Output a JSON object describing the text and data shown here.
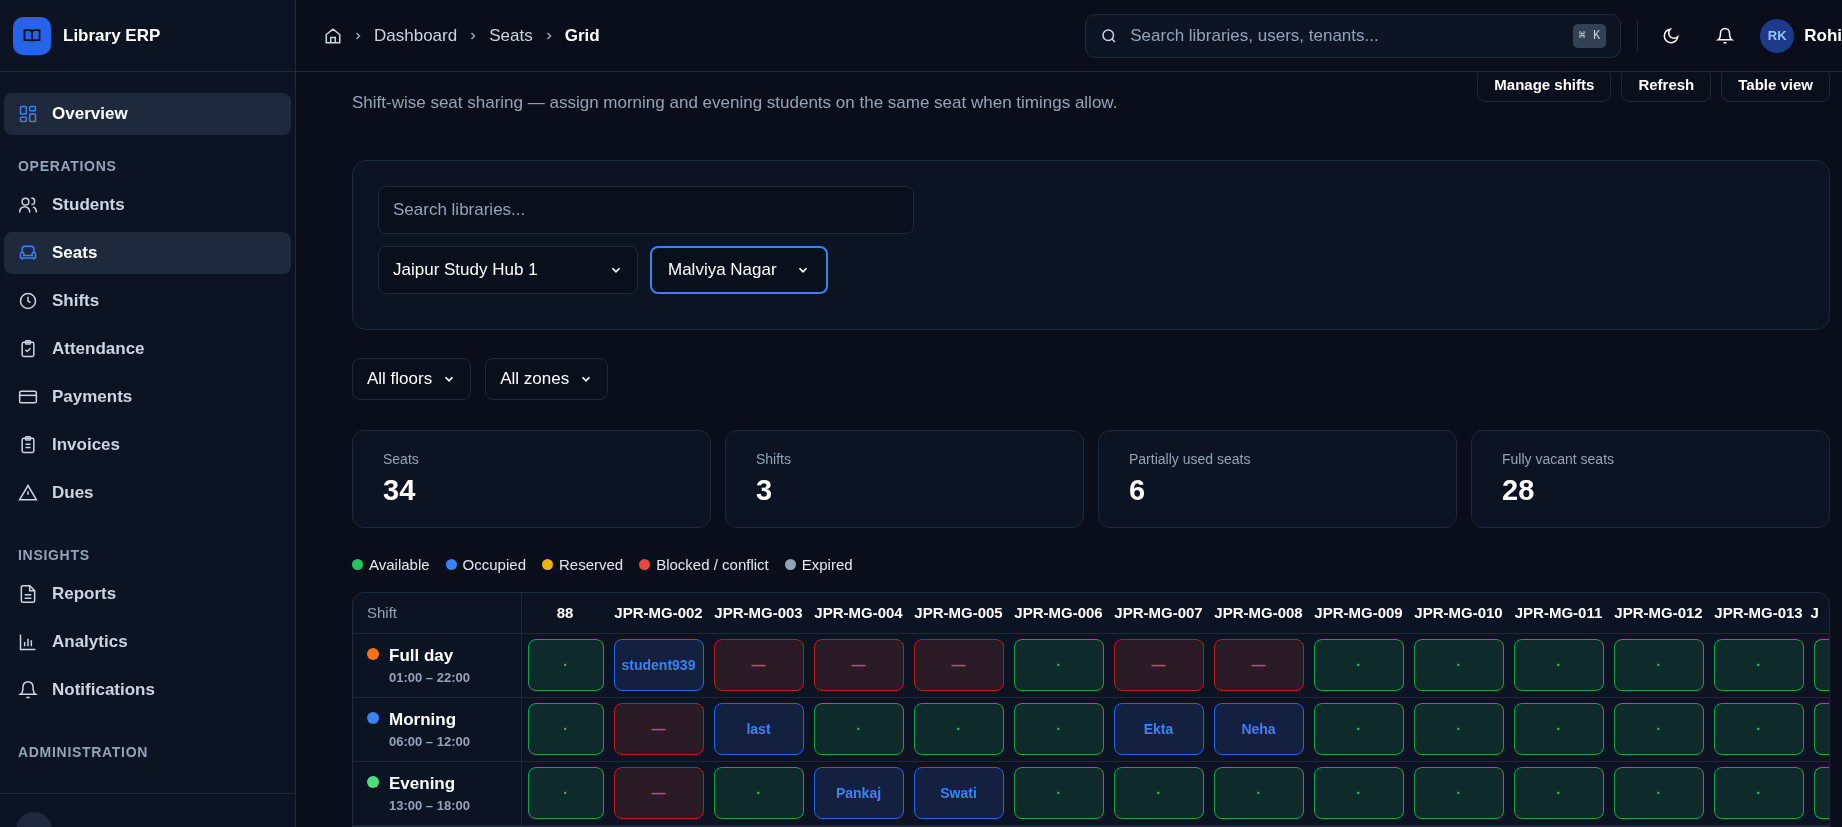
{
  "app": {
    "name": "Library ERP"
  },
  "sidebar": {
    "sections": [
      {
        "items": [
          {
            "label": "Overview",
            "selected": true
          }
        ]
      },
      {
        "title": "OPERATIONS",
        "items": [
          {
            "label": "Students",
            "selected": false
          },
          {
            "label": "Seats",
            "selected": true
          },
          {
            "label": "Shifts",
            "selected": false
          },
          {
            "label": "Attendance",
            "selected": false
          },
          {
            "label": "Payments",
            "selected": false
          },
          {
            "label": "Invoices",
            "selected": false
          },
          {
            "label": "Dues",
            "selected": false
          }
        ]
      },
      {
        "title": "INSIGHTS",
        "items": [
          {
            "label": "Reports",
            "selected": false
          },
          {
            "label": "Analytics",
            "selected": false
          },
          {
            "label": "Notifications",
            "selected": false
          }
        ]
      },
      {
        "title": "ADMINISTRATION"
      }
    ]
  },
  "breadcrumb": [
    "Dashboard",
    "Seats",
    "Grid"
  ],
  "search": {
    "placeholder": "Search libraries, users, tenants...",
    "shortcut": "⌘ K"
  },
  "user": {
    "initials": "RK",
    "name": "Rohi"
  },
  "subtitle": "Shift-wise seat sharing — assign morning and evening students on the same seat when timings allow.",
  "actions": [
    "Manage shifts",
    "Refresh",
    "Table view"
  ],
  "library_filter": {
    "placeholder": "Search libraries...",
    "library": "Jaipur Study Hub 1",
    "branch": "Malviya Nagar"
  },
  "filters": [
    "All floors",
    "All zones"
  ],
  "stats": [
    {
      "label": "Seats",
      "value": "34"
    },
    {
      "label": "Shifts",
      "value": "3"
    },
    {
      "label": "Partially used seats",
      "value": "6"
    },
    {
      "label": "Fully vacant seats",
      "value": "28"
    }
  ],
  "legend": [
    {
      "label": "Available",
      "color": "#22c55e"
    },
    {
      "label": "Occupied",
      "color": "#3b82f6"
    },
    {
      "label": "Reserved",
      "color": "#eab308"
    },
    {
      "label": "Blocked / conflict",
      "color": "#ef4444"
    },
    {
      "label": "Expired",
      "color": "#94a3b8"
    }
  ],
  "table": {
    "shift_header": "Shift",
    "columns": [
      "88",
      "JPR-MG-002",
      "JPR-MG-003",
      "JPR-MG-004",
      "JPR-MG-005",
      "JPR-MG-006",
      "JPR-MG-007",
      "JPR-MG-008",
      "JPR-MG-009",
      "JPR-MG-010",
      "JPR-MG-011",
      "JPR-MG-012",
      "JPR-MG-013",
      "J"
    ],
    "rows": [
      {
        "name": "Full day",
        "time": "01:00 – 22:00",
        "color": "#f97316",
        "cells": [
          {
            "kind": "available",
            "text": "·"
          },
          {
            "kind": "occupied",
            "text": "student939"
          },
          {
            "kind": "blocked",
            "text": "—"
          },
          {
            "kind": "blocked",
            "text": "—"
          },
          {
            "kind": "blocked",
            "text": "—"
          },
          {
            "kind": "available",
            "text": "·"
          },
          {
            "kind": "blocked",
            "text": "—"
          },
          {
            "kind": "blocked",
            "text": "—"
          },
          {
            "kind": "available",
            "text": "·"
          },
          {
            "kind": "available",
            "text": "·"
          },
          {
            "kind": "available",
            "text": "·"
          },
          {
            "kind": "available",
            "text": "·"
          },
          {
            "kind": "available",
            "text": "·"
          },
          {
            "kind": "available"
          }
        ]
      },
      {
        "name": "Morning",
        "time": "06:00 – 12:00",
        "color": "#3b82f6",
        "cells": [
          {
            "kind": "available",
            "text": "·"
          },
          {
            "kind": "blocked",
            "text": "—"
          },
          {
            "kind": "occupied",
            "text": "last"
          },
          {
            "kind": "available",
            "text": "·"
          },
          {
            "kind": "available",
            "text": "·"
          },
          {
            "kind": "available",
            "text": "·"
          },
          {
            "kind": "occupied",
            "text": "Ekta"
          },
          {
            "kind": "occupied",
            "text": "Neha"
          },
          {
            "kind": "available",
            "text": "·"
          },
          {
            "kind": "available",
            "text": "·"
          },
          {
            "kind": "available",
            "text": "·"
          },
          {
            "kind": "available",
            "text": "·"
          },
          {
            "kind": "available",
            "text": "·"
          },
          {
            "kind": "available"
          }
        ]
      },
      {
        "name": "Evening",
        "time": "13:00 – 18:00",
        "color": "#4ade80",
        "cells": [
          {
            "kind": "available",
            "text": "·"
          },
          {
            "kind": "blocked",
            "text": "—"
          },
          {
            "kind": "available",
            "text": "·"
          },
          {
            "kind": "occupied",
            "text": "Pankaj"
          },
          {
            "kind": "occupied",
            "text": "Swati"
          },
          {
            "kind": "available",
            "text": "·"
          },
          {
            "kind": "available",
            "text": "·"
          },
          {
            "kind": "available",
            "text": "·"
          },
          {
            "kind": "available",
            "text": "·"
          },
          {
            "kind": "available",
            "text": "·"
          },
          {
            "kind": "available",
            "text": "·"
          },
          {
            "kind": "available",
            "text": "·"
          },
          {
            "kind": "available",
            "text": "·"
          },
          {
            "kind": "available"
          }
        ]
      }
    ]
  }
}
